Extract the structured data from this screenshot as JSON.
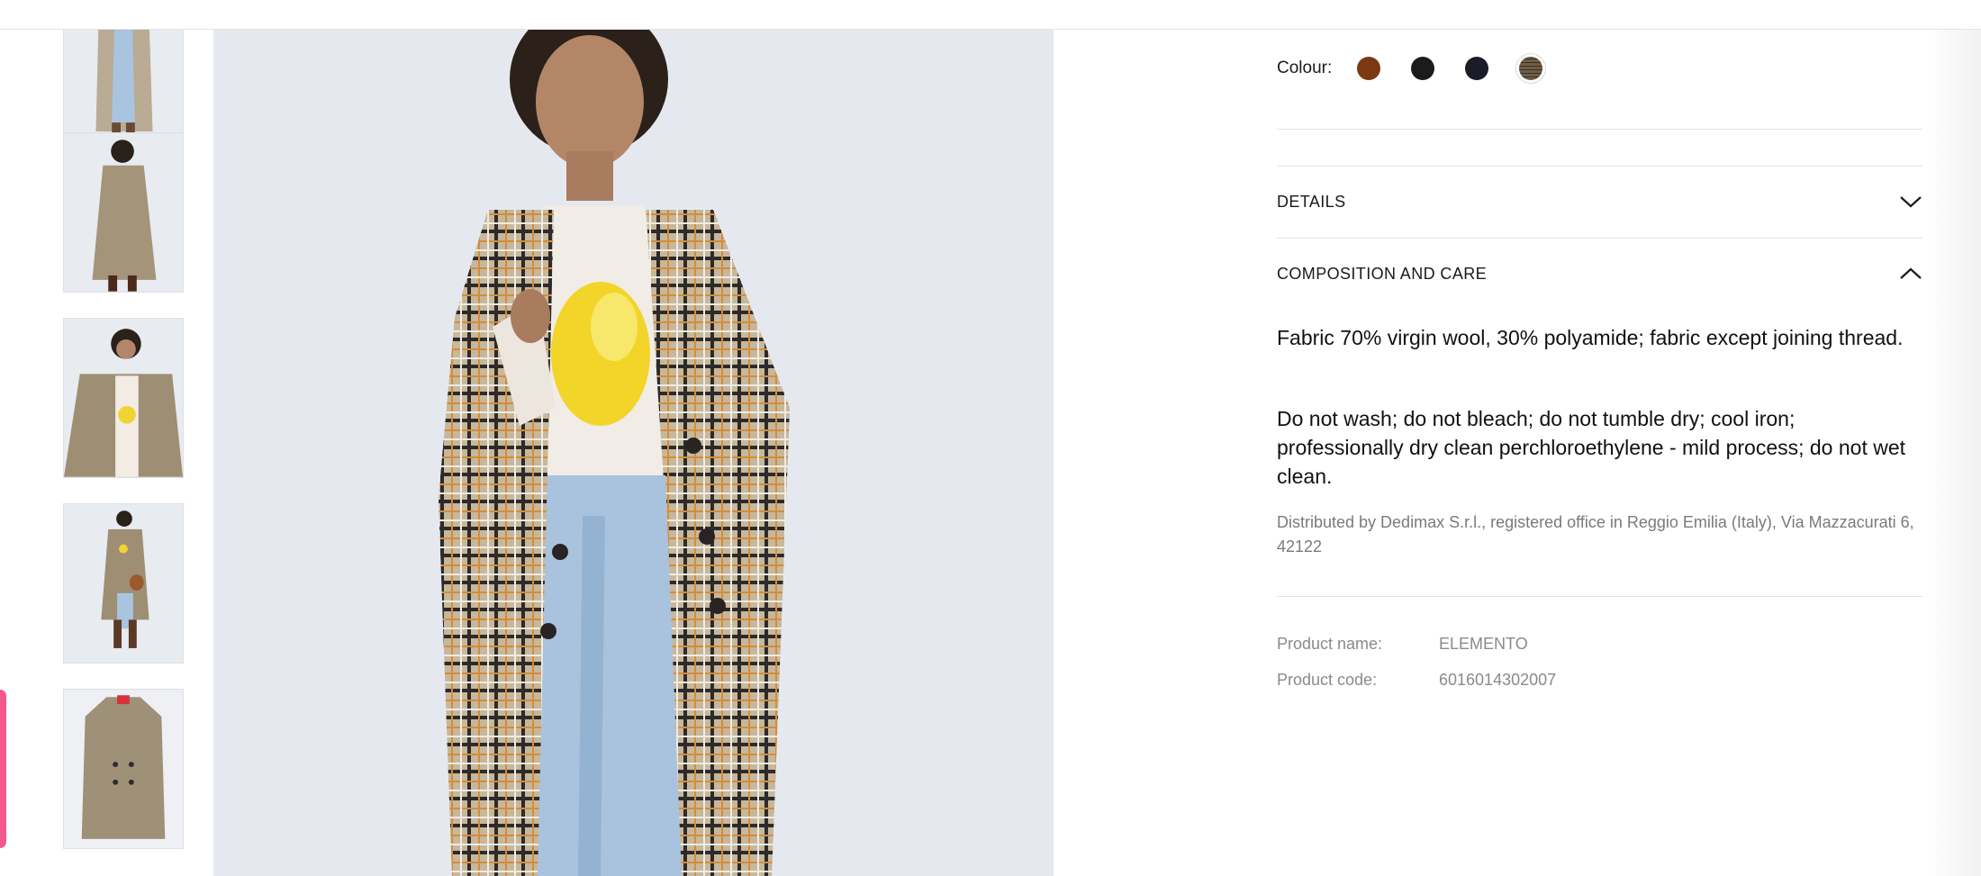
{
  "colour": {
    "label": "Colour:",
    "swatches": [
      {
        "name": "brown",
        "color": "#7a3910"
      },
      {
        "name": "black",
        "color": "#1b1b1b"
      },
      {
        "name": "navy",
        "color": "#1a1c2a"
      },
      {
        "name": "check",
        "color": "#a89b86",
        "selected": true
      }
    ]
  },
  "accordions": {
    "details": {
      "title": "DETAILS",
      "expanded": false
    },
    "composition": {
      "title": "COMPOSITION AND CARE",
      "expanded": true,
      "fabric": "Fabric 70% virgin wool, 30% polyamide; fabric except joining thread.",
      "care": "Do not wash; do not bleach; do not tumble dry; cool iron; professionally dry clean perchloroethylene - mild process; do not wet clean.",
      "distributor": "Distributed by Dedimax S.r.l., registered office in Reggio Emilia (Italy), Via Mazzacurati 6, 42122"
    }
  },
  "product": {
    "name_label": "Product name:",
    "name_value": "ELEMENTO",
    "code_label": "Product code:",
    "code_value": "6016014302007"
  },
  "colors": {
    "accent_pink": "#f2578d",
    "divider": "#e3e3e3",
    "muted_text": "#8a8a8a"
  }
}
